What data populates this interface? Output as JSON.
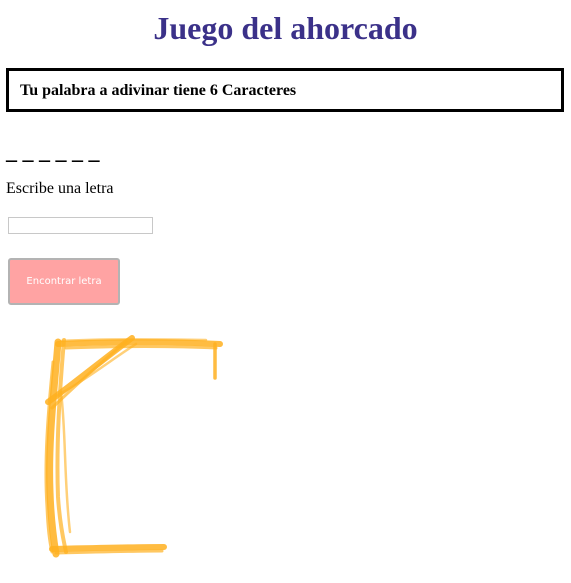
{
  "page": {
    "title": "Juego del ahorcado"
  },
  "info": {
    "message": "Tu palabra a adivinar tiene 6 Caracteres"
  },
  "word": {
    "blanks": "_ _ _ _ _ _"
  },
  "form": {
    "prompt": "Escribe una letra",
    "input_value": "",
    "button_label": "Encontrar letra"
  },
  "colors": {
    "title": "#3b3189",
    "button_bg": "#ffa3a3",
    "gallows": "#ffb020"
  },
  "drawing": {
    "icon": "gallows-drawing"
  }
}
